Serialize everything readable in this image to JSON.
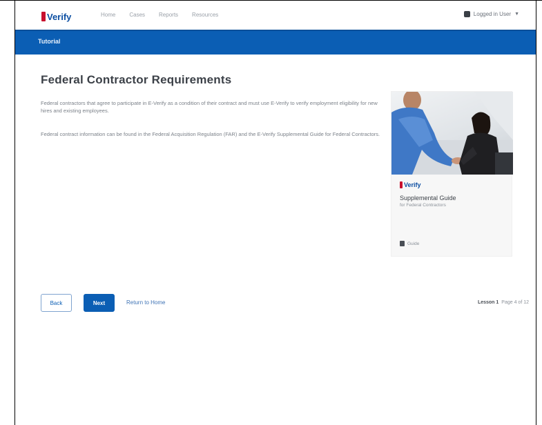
{
  "app": {
    "logo_text": "Verify",
    "brand_color": "#0b5eb4",
    "logo_accent": "#c8102e"
  },
  "nav": {
    "items": [
      "Home",
      "Cases",
      "Reports",
      "Resources"
    ]
  },
  "user": {
    "label": "Logged in User",
    "icon": "user-icon"
  },
  "banner": {
    "title": "Tutorial"
  },
  "content": {
    "title": "Federal Contractor Requirements",
    "paragraph1": "Federal contractors that agree to participate in E-Verify as a condition of their contract and must use E-Verify to verify employment eligibility for new hires and existing employees.",
    "paragraph2": "Federal contract information can be found in the Federal Acquisition Regulation (FAR) and the E-Verify Supplemental Guide for Federal Contractors."
  },
  "card": {
    "logo_text": "Verify",
    "title": "Supplemental Guide",
    "subtitle": "for Federal Contractors",
    "footer_text": "Guide",
    "photo_desc": "handshake-photo"
  },
  "footer": {
    "back_label": "Back",
    "next_label": "Next",
    "return_label": "Return to Home",
    "pager_section": "Lesson 1",
    "pager_text": "Page 4 of 12"
  }
}
